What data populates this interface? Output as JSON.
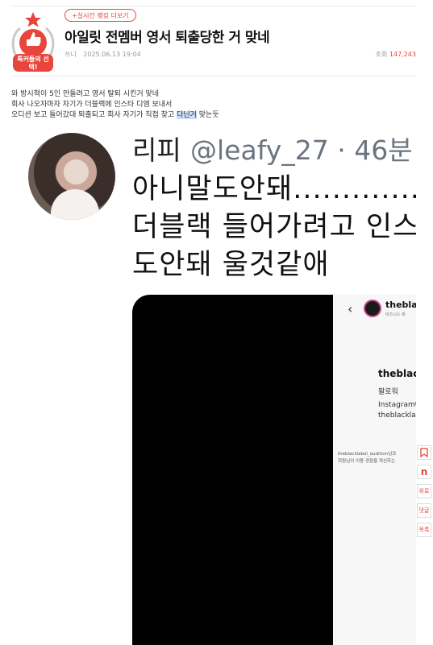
{
  "header": {
    "tag_label": "+실시간 랭킹 더보기",
    "badge_text": "톡커들의 선택!",
    "title": "아일릿 전멤버 영서 퇴출당한 거 맞네",
    "author_label": "쓰니",
    "date": "2025.06.13 19:04",
    "views_label": "조회",
    "views_count": "147,243"
  },
  "body": {
    "line1": "와 방시혁이 5인 만들려고 영서 탈퇴 시킨거 맞네",
    "line2": "회사 나오자마자 자기가 더블랙에 인스타 디엠 보내서",
    "line3_before": "오디션 보고 들어갔대 퇴출되고 회사 자기가 직접 찾고 ",
    "line3_highlight": "다닌거",
    "line3_after": " 맞는듯"
  },
  "tweet": {
    "name": "리피",
    "handle": "@leafy_27 · 46분",
    "text_line1": "아니말도안돼...............",
    "text_line2": "더블랙 들어가려고 인스타",
    "text_line3": "도안돼 울것같애"
  },
  "instagram": {
    "back_icon": "‹",
    "name": "theblac",
    "sub": "비즈니스 채",
    "big_name": "theblac",
    "follow": "팔로워",
    "line_ig": "Instagram에",
    "line_handle": "theblackla",
    "small1": "theblacklabel_audition님과",
    "small2": "회원님의 이용 경험을 개선하는"
  },
  "sidebar": {
    "bookmark_icon": "bookmark-icon",
    "n_label": "n",
    "up_label": "위로",
    "comment_label": "댓글",
    "list_label": "목록"
  },
  "colors": {
    "accent": "#e8453c"
  }
}
